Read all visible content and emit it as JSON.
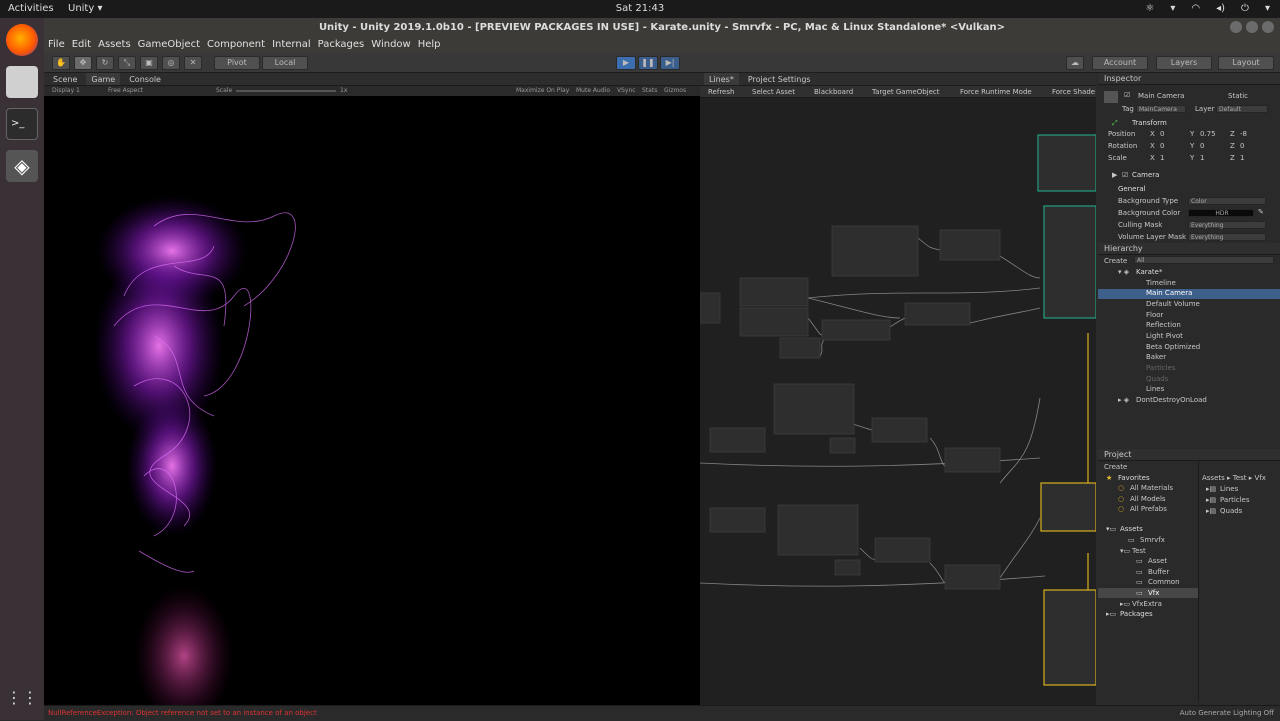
{
  "topbar": {
    "activities": "Activities",
    "app_menu": "Unity ▾",
    "clock": "Sat 21:43"
  },
  "window_title": "Unity - Unity 2019.1.0b10 - [PREVIEW PACKAGES IN USE] - Karate.unity - Smrvfx - PC, Mac & Linux Standalone* <Vulkan>",
  "menu": [
    "File",
    "Edit",
    "Assets",
    "GameObject",
    "Component",
    "Internal",
    "Packages",
    "Window",
    "Help"
  ],
  "toolbar": {
    "pivot": "Pivot",
    "local": "Local",
    "account": "Account",
    "layers": "Layers",
    "layout": "Layout"
  },
  "game_panel": {
    "tabs": [
      "Scene",
      "Game",
      "Console"
    ],
    "display": "Display 1",
    "aspect": "Free Aspect",
    "scale_label": "Scale",
    "scale_value": "1x",
    "maximize": "Maximize On Play",
    "mute": "Mute Audio",
    "vsync": "VSync",
    "stats": "Stats",
    "gizmos": "Gizmos"
  },
  "vfx_panel": {
    "tabs": [
      "Lines*",
      "Project Settings"
    ],
    "toolbar": [
      "Refresh",
      "Select Asset",
      "Blackboard",
      "Target GameObject",
      "Force Runtime Mode",
      "Force Shade"
    ]
  },
  "inspector": {
    "title": "Inspector",
    "object_name": "Main Camera",
    "static": "Static",
    "tag_label": "Tag",
    "tag_value": "MainCamera",
    "layer_label": "Layer",
    "layer_value": "Default",
    "transform": "Transform",
    "position": {
      "label": "Position",
      "x": "0",
      "y": "0.75",
      "z": "-8"
    },
    "rotation": {
      "label": "Rotation",
      "x": "0",
      "y": "0",
      "z": "0"
    },
    "scale": {
      "label": "Scale",
      "x": "1",
      "y": "1",
      "z": "1"
    },
    "camera": "Camera",
    "general": "General",
    "bg_type_label": "Background Type",
    "bg_type_value": "Color",
    "bg_color_label": "Background Color",
    "bg_color_value": "HDR",
    "culling_label": "Culling Mask",
    "culling_value": "Everything",
    "volume_label": "Volume Layer Mask",
    "volume_value": "Everything"
  },
  "hierarchy": {
    "title": "Hierarchy",
    "create": "Create",
    "search": "All",
    "scene": "Karate*",
    "items": [
      {
        "label": "Timeline",
        "dim": false
      },
      {
        "label": "Main Camera",
        "dim": false
      },
      {
        "label": "Default Volume",
        "dim": false
      },
      {
        "label": "Floor",
        "dim": false
      },
      {
        "label": "Reflection",
        "dim": false
      },
      {
        "label": "Light Pivot",
        "dim": false
      },
      {
        "label": "Beta Optimized",
        "dim": false
      },
      {
        "label": "Baker",
        "dim": false
      },
      {
        "label": "Particles",
        "dim": true
      },
      {
        "label": "Quads",
        "dim": true
      },
      {
        "label": "Lines",
        "dim": false
      }
    ],
    "dontdestroy": "DontDestroyOnLoad"
  },
  "project": {
    "title": "Project",
    "create": "Create",
    "favorites": "Favorites",
    "fav_items": [
      "All Materials",
      "All Models",
      "All Prefabs"
    ],
    "assets": "Assets",
    "tree": [
      {
        "label": "Smrvfx",
        "indent": 1
      },
      {
        "label": "Test",
        "indent": 1
      },
      {
        "label": "Asset",
        "indent": 2
      },
      {
        "label": "Buffer",
        "indent": 2
      },
      {
        "label": "Common",
        "indent": 2
      },
      {
        "label": "Vfx",
        "indent": 2
      },
      {
        "label": "VfxExtra",
        "indent": 1
      }
    ],
    "packages": "Packages",
    "breadcrumb": "Assets ▸ Test ▸ Vfx",
    "files": [
      "Lines",
      "Particles",
      "Quads"
    ]
  },
  "status": {
    "error": "NullReferenceException: Object reference not set to an instance of an object",
    "lighting": "Auto Generate Lighting Off"
  },
  "colors": {
    "particle": "#c040ff",
    "accent_yellow": "#d8b020",
    "accent_teal": "#20a080",
    "error": "#dd3333"
  }
}
